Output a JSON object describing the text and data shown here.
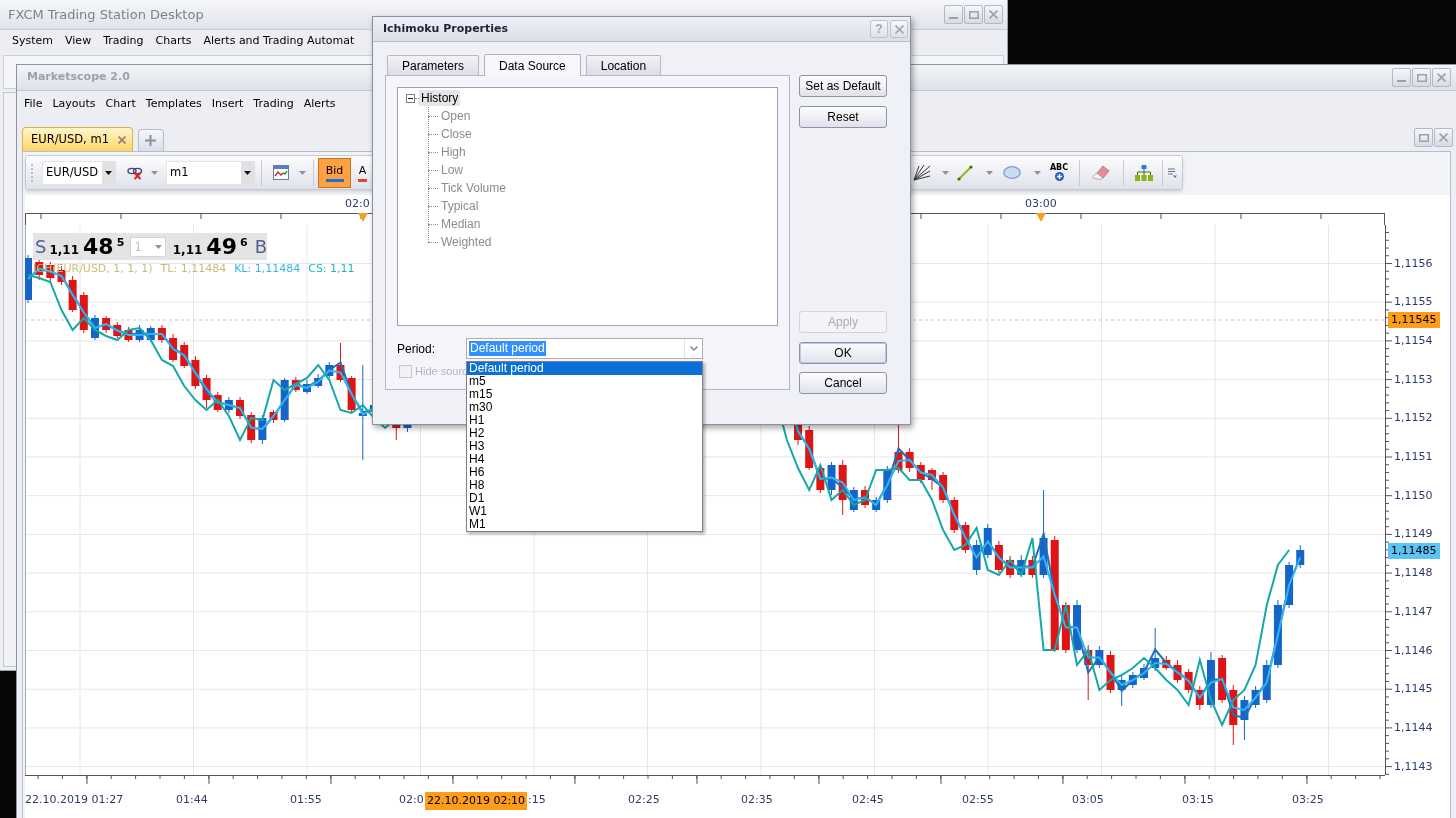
{
  "main_window": {
    "title": "FXCM Trading Station Desktop",
    "menu": [
      "System",
      "View",
      "Trading",
      "Charts",
      "Alerts and Trading Automat"
    ]
  },
  "marketscope": {
    "title": "Marketscope 2.0",
    "menu": [
      "File",
      "Layouts",
      "Chart",
      "Templates",
      "Insert",
      "Trading",
      "Alerts"
    ],
    "tabs": [
      {
        "label": "EUR/USD, m1",
        "selected": true
      }
    ],
    "toolbar": {
      "symbol": "EUR/USD",
      "timeframe": "m1",
      "price_buttons": [
        {
          "label": "Bid",
          "selected": true,
          "color": "#1a6fd8"
        },
        {
          "label": "A",
          "selected": false,
          "color": "#e2452a"
        }
      ],
      "text_tool": "ABC"
    },
    "chart": {
      "quote": {
        "sell_label": "S",
        "sell_prefix": "1,11",
        "sell_pips": "48",
        "sell_fraction": "5",
        "amount": "1",
        "buy_prefix": "1,11",
        "buy_pips": "49",
        "buy_fraction": "6",
        "buy_label": "B"
      },
      "legend": [
        {
          "text": "ICH(EUR/USD, 1, 1, 1)",
          "color": "#c8bd76"
        },
        {
          "text": "TL: 1,11484",
          "color": "#c8bd76"
        },
        {
          "text": "KL: 1,11484",
          "color": "#36b4ec"
        },
        {
          "text": "CS: 1,11",
          "color": "#19b9b2"
        }
      ],
      "top_axis_labels": [
        "02:0",
        "03:00"
      ],
      "price_axis_labels": [
        "1,1156",
        "1,1155",
        "1,1154",
        "1,1153",
        "1,1152",
        "1,1151",
        "1,1150",
        "1,1149",
        "1,1148",
        "1,1147",
        "1,1146",
        "1,1145",
        "1,1144",
        "1,1143"
      ],
      "price_markers": [
        {
          "label": "1,11545",
          "color": "#ff9c1a"
        },
        {
          "label": "1,11485",
          "color": "#5cc3f5"
        }
      ],
      "time_axis_labels": [
        "22.10.2019 01:27",
        "01:44",
        "01:55",
        "02:0",
        ":15",
        "02:25",
        "02:35",
        "02:45",
        "02:55",
        "03:05",
        "03:15",
        "03:25"
      ],
      "cursor_time": "22.10.2019 02:10"
    }
  },
  "dialog": {
    "title": "Ichimoku Properties",
    "help": "?",
    "tabs": [
      {
        "label": "Parameters",
        "selected": false
      },
      {
        "label": "Data Source",
        "selected": true
      },
      {
        "label": "Location",
        "selected": false
      }
    ],
    "tree": [
      {
        "label": "History",
        "selected": true,
        "expanded": true,
        "children": [
          {
            "label": "Open",
            "selected": false,
            "disabled": true
          },
          {
            "label": "Close",
            "selected": false,
            "disabled": true
          },
          {
            "label": "High",
            "selected": false,
            "disabled": true
          },
          {
            "label": "Low",
            "selected": false,
            "disabled": true
          },
          {
            "label": "Tick Volume",
            "selected": false,
            "disabled": true
          },
          {
            "label": "Typical",
            "selected": false,
            "disabled": true
          },
          {
            "label": "Median",
            "selected": false,
            "disabled": true
          },
          {
            "label": "Weighted",
            "selected": false,
            "disabled": true
          }
        ]
      }
    ],
    "period": {
      "label": "Period:",
      "value": "Default period",
      "expanded": true,
      "options": [
        {
          "label": "Default period",
          "selected": true
        },
        {
          "label": "m5",
          "selected": false
        },
        {
          "label": "m15",
          "selected": false
        },
        {
          "label": "m30",
          "selected": false
        },
        {
          "label": "H1",
          "selected": false
        },
        {
          "label": "H2",
          "selected": false
        },
        {
          "label": "H3",
          "selected": false
        },
        {
          "label": "H4",
          "selected": false
        },
        {
          "label": "H6",
          "selected": false
        },
        {
          "label": "H8",
          "selected": false
        },
        {
          "label": "D1",
          "selected": false
        },
        {
          "label": "W1",
          "selected": false
        },
        {
          "label": "M1",
          "selected": false
        }
      ]
    },
    "hide_source": {
      "label": "Hide sourc",
      "checked": false,
      "disabled": true
    },
    "buttons_top": [
      {
        "label": "Set as Default",
        "disabled": false,
        "default": false
      },
      {
        "label": "Reset",
        "disabled": false,
        "default": false
      }
    ],
    "buttons_bottom": [
      {
        "label": "Apply",
        "disabled": true,
        "default": false
      },
      {
        "label": "OK",
        "disabled": false,
        "default": true
      },
      {
        "label": "Cancel",
        "disabled": false,
        "default": false
      }
    ]
  }
}
